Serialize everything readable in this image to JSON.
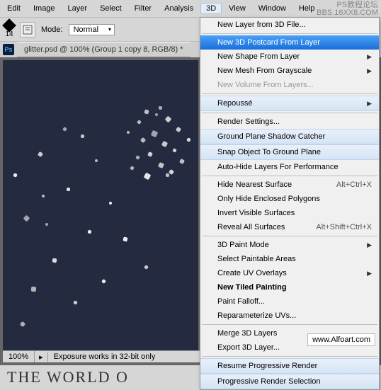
{
  "menubar": {
    "items": [
      "Edit",
      "Image",
      "Layer",
      "Select",
      "Filter",
      "Analysis",
      "3D",
      "View",
      "Window",
      "Help"
    ],
    "active_index": 6
  },
  "toolbar": {
    "size_value": "14",
    "mode_label": "Mode:",
    "mode_value": "Normal"
  },
  "document": {
    "tab_title": "glitter.psd @ 100% (Group 1 copy 8, RGB/8) *"
  },
  "statusbar": {
    "zoom": "100%",
    "info": "Exposure works in 32-bit only"
  },
  "dropdown": {
    "items": [
      {
        "label": "New Layer from 3D File...",
        "type": "normal"
      },
      {
        "type": "sep"
      },
      {
        "label": "New 3D Postcard From Layer",
        "type": "highlighted"
      },
      {
        "label": "New Shape From Layer",
        "type": "normal",
        "submenu": true
      },
      {
        "label": "New Mesh From Grayscale",
        "type": "normal",
        "submenu": true
      },
      {
        "label": "New Volume From Layers...",
        "type": "disabled"
      },
      {
        "type": "sep"
      },
      {
        "label": "Repoussé",
        "type": "soft",
        "submenu": true
      },
      {
        "type": "sep"
      },
      {
        "label": "Render Settings...",
        "type": "normal"
      },
      {
        "label": "Ground Plane Shadow Catcher",
        "type": "soft"
      },
      {
        "label": "Snap Object To Ground Plane",
        "type": "soft"
      },
      {
        "label": "Auto-Hide Layers For Performance",
        "type": "normal"
      },
      {
        "type": "sep"
      },
      {
        "label": "Hide Nearest Surface",
        "type": "normal",
        "shortcut": "Alt+Ctrl+X"
      },
      {
        "label": "Only Hide Enclosed Polygons",
        "type": "normal"
      },
      {
        "label": "Invert Visible Surfaces",
        "type": "normal"
      },
      {
        "label": "Reveal All Surfaces",
        "type": "normal",
        "shortcut": "Alt+Shift+Ctrl+X"
      },
      {
        "type": "sep"
      },
      {
        "label": "3D Paint Mode",
        "type": "normal",
        "submenu": true
      },
      {
        "label": "Select Paintable Areas",
        "type": "normal"
      },
      {
        "label": "Create UV Overlays",
        "type": "normal",
        "submenu": true
      },
      {
        "label": "New Tiled Painting",
        "type": "bold"
      },
      {
        "label": "Paint Falloff...",
        "type": "normal"
      },
      {
        "label": "Reparameterize UVs...",
        "type": "normal"
      },
      {
        "type": "sep"
      },
      {
        "label": "Merge 3D Layers",
        "type": "normal"
      },
      {
        "label": "Export 3D Layer...",
        "type": "normal"
      },
      {
        "type": "sep"
      },
      {
        "label": "Resume Progressive Render",
        "type": "soft"
      },
      {
        "label": "Progressive Render Selection",
        "type": "soft"
      }
    ]
  },
  "watermark": {
    "text": "www.Alfoart.com"
  },
  "watermark2": {
    "line1": "PS教程论坛",
    "line2": "BBS.16XX8.COM"
  },
  "ps_badge": "Ps",
  "below_text": "THE WORLD O"
}
